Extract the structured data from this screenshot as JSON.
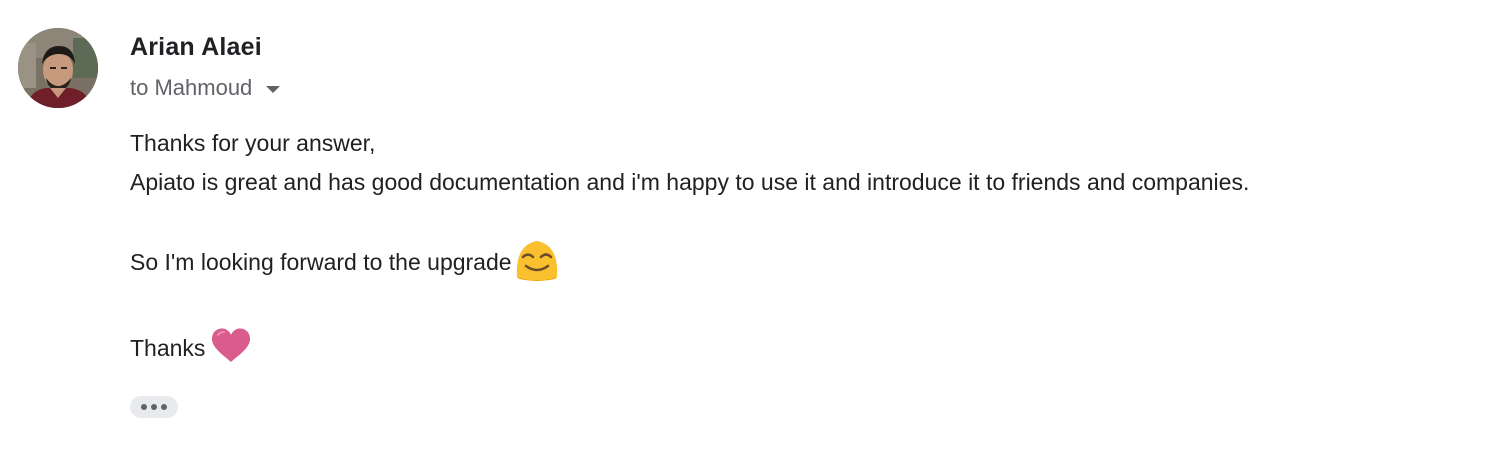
{
  "message": {
    "sender_name": "Arian Alaei",
    "recipient_text": "to Mahmoud",
    "body": {
      "line1": "Thanks for your answer,",
      "line2": "Apiato is great and has good documentation and i'm happy to use it and introduce it to friends and companies.",
      "line3": "So I'm looking forward to the upgrade",
      "line4": "Thanks"
    },
    "emoji": {
      "smile": "smiling-face-icon",
      "heart": "heart-icon"
    },
    "more_button_icon": "more-horizontal-icon"
  },
  "colors": {
    "text": "#202124",
    "secondary_text": "#5f6368",
    "chip_background": "#e8eaed",
    "smile_yellow": "#fbc02d",
    "heart_pink": "#d95c8c"
  }
}
